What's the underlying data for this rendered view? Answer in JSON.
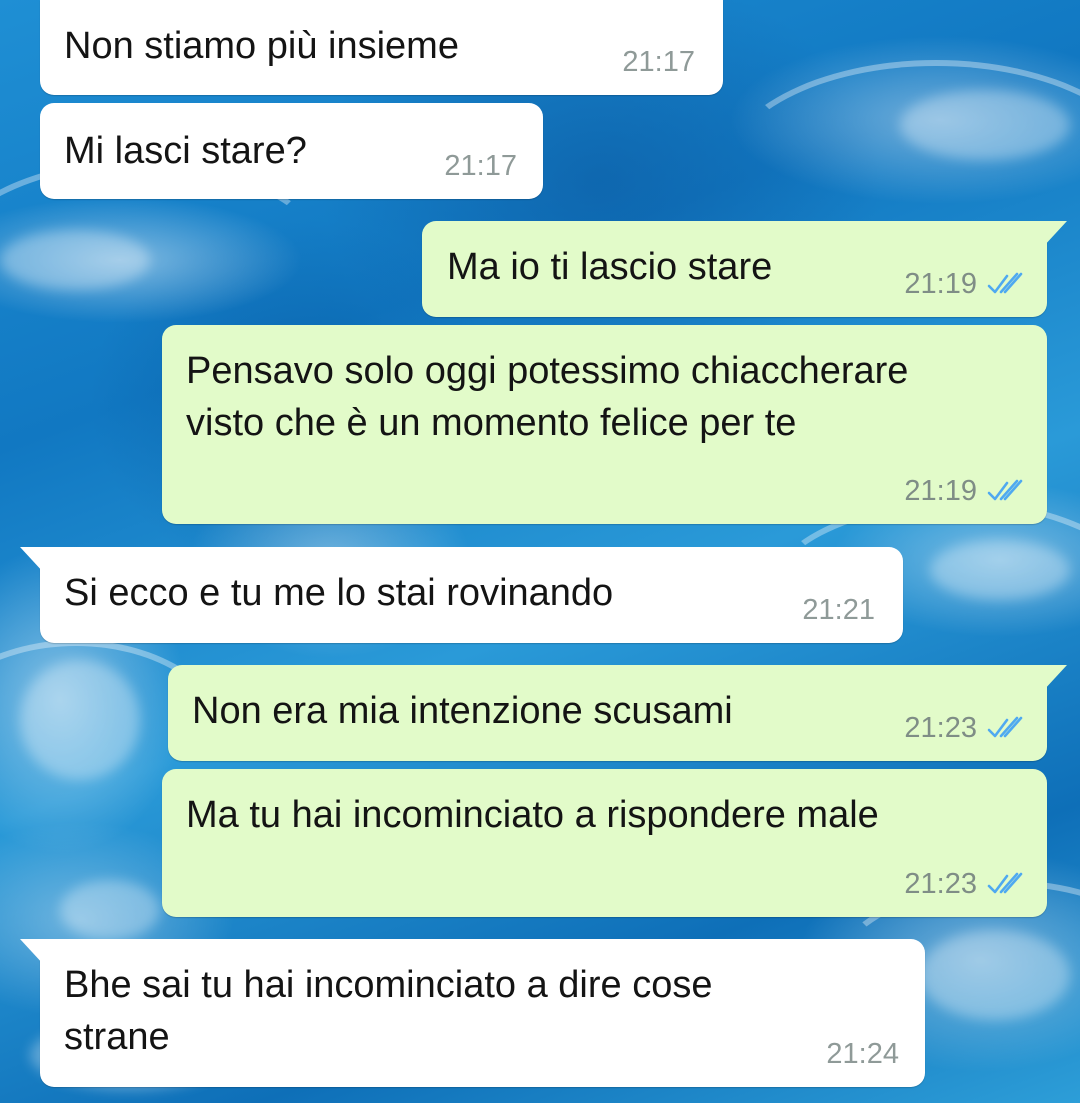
{
  "theme": {
    "incoming_bubble": "#ffffff",
    "outgoing_bubble": "#e2fbc9",
    "read_tick_color": "#4fa9f0",
    "timestamp_color": "#8f9a98",
    "wallpaper": "#1a84cc"
  },
  "messages": [
    {
      "direction": "incoming",
      "text": "Non stiamo più insieme",
      "time": "21:17"
    },
    {
      "direction": "incoming",
      "text": "Mi lasci stare?",
      "time": "21:17"
    },
    {
      "direction": "outgoing",
      "text": "Ma io ti lascio stare",
      "time": "21:19",
      "status": "read-double-check-icon"
    },
    {
      "direction": "outgoing",
      "text": "Pensavo solo oggi potessimo chiaccherare\nvisto che è un momento felice per te",
      "time": "21:19",
      "status": "read-double-check-icon"
    },
    {
      "direction": "incoming",
      "text": "Si ecco e tu me lo stai rovinando",
      "time": "21:21"
    },
    {
      "direction": "outgoing",
      "text": "Non era mia intenzione scusami",
      "time": "21:23",
      "status": "read-double-check-icon"
    },
    {
      "direction": "outgoing",
      "text": "Ma tu hai incominciato a rispondere male",
      "time": "21:23",
      "status": "read-double-check-icon"
    },
    {
      "direction": "incoming",
      "text": "Bhe sai tu hai incominciato a dire cose\nstrane",
      "time": "21:24"
    }
  ]
}
